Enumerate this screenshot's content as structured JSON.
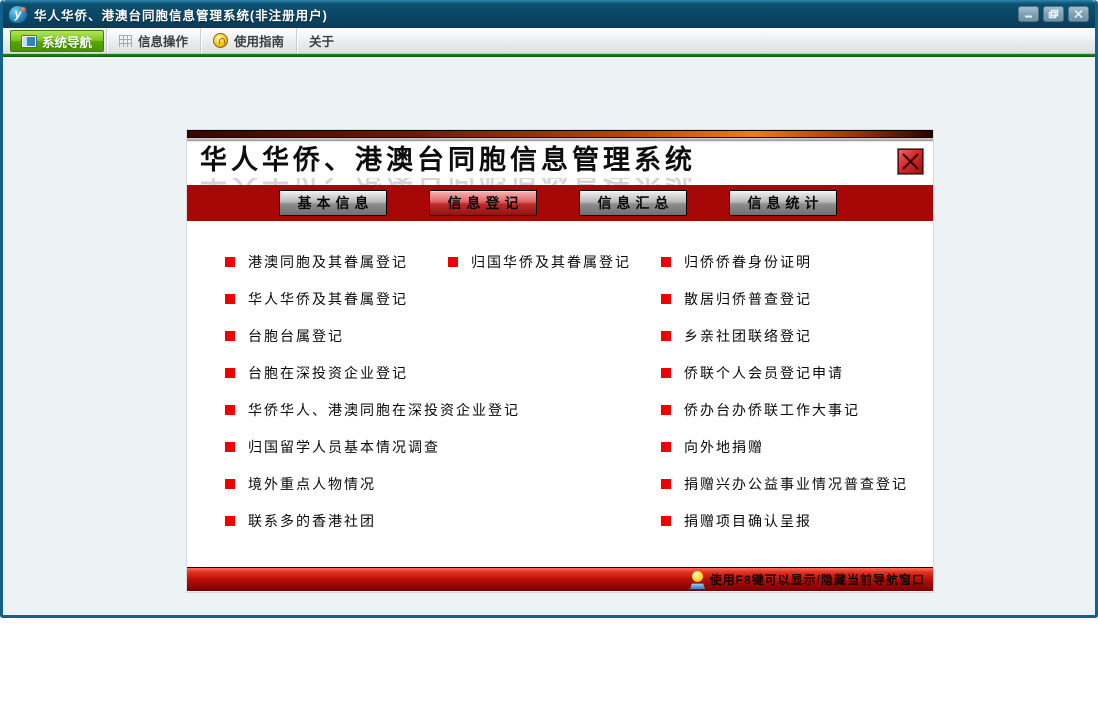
{
  "window": {
    "title": "华人华侨、港澳台同胞信息管理系统(非注册用户)",
    "app_icon_glyph": "y",
    "controls": {
      "minimize": "minimize-icon",
      "restore": "restore-icon",
      "close": "close-icon"
    }
  },
  "toolbar": {
    "tabs": [
      {
        "label": "系统导航",
        "icon": "window-icon",
        "active": true
      },
      {
        "label": "信息操作",
        "icon": "grid-icon",
        "active": false
      },
      {
        "label": "使用指南",
        "icon": "guide-icon",
        "active": false
      },
      {
        "label": "关于",
        "icon": "",
        "active": false
      }
    ]
  },
  "dialog": {
    "title": "华人华侨、港澳台同胞信息管理系统",
    "close_icon": "close-icon",
    "nav_buttons": [
      {
        "label": "基本信息",
        "active": false
      },
      {
        "label": "信息登记",
        "active": true
      },
      {
        "label": "信息汇总",
        "active": false
      },
      {
        "label": "信息统计",
        "active": false
      }
    ],
    "menu": {
      "col1": [
        "港澳同胞及其眷属登记",
        "华人华侨及其眷属登记",
        "台胞台属登记",
        "台胞在深投资企业登记",
        "华侨华人、港澳同胞在深投资企业登记",
        "归国留学人员基本情况调查",
        "境外重点人物情况",
        "联系多的香港社团"
      ],
      "col2": [
        "归国华侨及其眷属登记"
      ],
      "col3": [
        "归侨侨眷身份证明",
        "散居归侨普查登记",
        "乡亲社团联络登记",
        "侨联个人会员登记申请",
        "侨办台办侨联工作大事记",
        "向外地捐赠",
        "捐赠兴办公益事业情况普查登记",
        "捐赠项目确认呈报"
      ]
    },
    "status_bar": {
      "hint": "使用F8键可以显示/隐藏当前导航窗口",
      "icon": "lightbulb-icon"
    }
  },
  "colors": {
    "titlebar": "#0a4563",
    "active_tab_green": "#7cc51e",
    "dialog_red": "#a80707",
    "bullet_red": "#f00000",
    "selected_button_red": "#e06262"
  }
}
